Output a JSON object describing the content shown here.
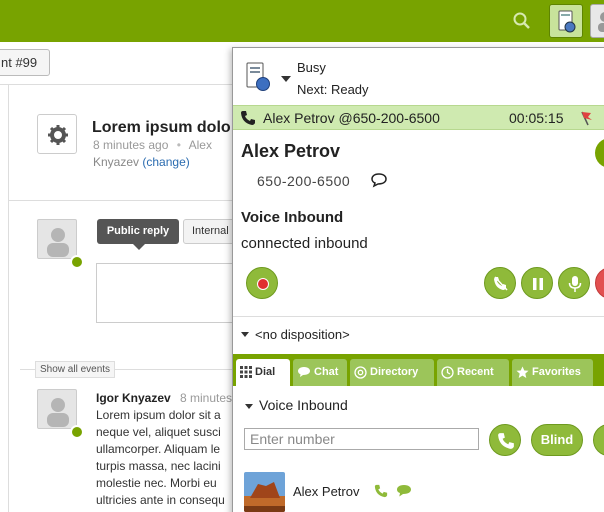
{
  "topbar": {
    "search_icon": "search-icon",
    "phone_icon": "softphone-icon",
    "user_icon": "user-icon"
  },
  "ticket": {
    "tab_label": "nt #99",
    "title": "Lorem ipsum dolo",
    "meta_time": "8 minutes ago",
    "meta_sep": "•",
    "meta_user": "Alex",
    "assignee": "Knyazev",
    "change_link": "(change)"
  },
  "reply": {
    "public_label": "Public reply",
    "internal_label": "Internal"
  },
  "events": {
    "show_all_label": "Show all events"
  },
  "comment": {
    "author": "Igor Knyazev",
    "time": "8 minutes",
    "lines": [
      "Lorem ipsum dolor sit a",
      "neque vel, aliquet susci",
      "ullamcorper. Aliquam le",
      "turpis massa, nec lacini",
      "molestie nec. Morbi eu",
      "ultricies ante in consequ"
    ]
  },
  "softphone": {
    "status": "Busy",
    "next": "Next: Ready",
    "call_party": "Alex Petrov @650-200-6500",
    "timer": "00:05:15",
    "caller_name": "Alex Petrov",
    "caller_phone": "650-200-6500",
    "call_type": "Voice Inbound",
    "call_state": "connected inbound",
    "disposition": "<no disposition>",
    "tabs": [
      {
        "label": "Dial",
        "icon": "keypad-icon"
      },
      {
        "label": "Chat",
        "icon": "chat-icon"
      },
      {
        "label": "Directory",
        "icon": "at-icon"
      },
      {
        "label": "Recent",
        "icon": "clock-icon"
      },
      {
        "label": "Favorites",
        "icon": "star-icon"
      }
    ],
    "dial_queue": "Voice Inbound",
    "number_placeholder": "Enter number",
    "blind_label": "Blind",
    "contact_name": "Alex Petrov",
    "colors": {
      "brand": "#78a300",
      "button": "#8fba3a",
      "callbar": "#cfeab0",
      "record": "#e03030"
    }
  }
}
